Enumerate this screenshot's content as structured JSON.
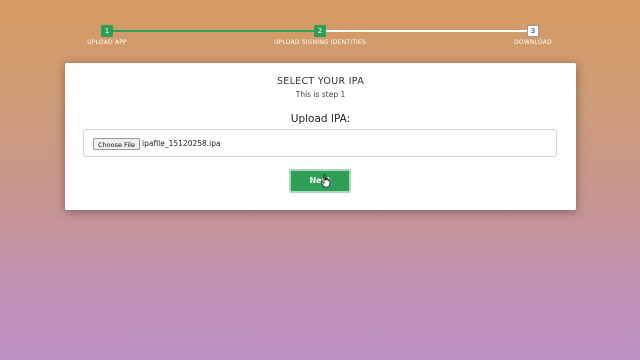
{
  "stepper": {
    "steps": [
      {
        "number": "1",
        "label": "UPLOAD APP",
        "state": "done"
      },
      {
        "number": "2",
        "label": "UPLOAD SIGNING IDENTITIES",
        "state": "done"
      },
      {
        "number": "3",
        "label": "DOWNLOAD",
        "state": "todo"
      }
    ]
  },
  "card": {
    "title": "SELECT YOUR IPA",
    "subtitle": "This is step 1",
    "upload_label": "Upload IPA:",
    "file_input": {
      "button_label": "Choose File",
      "file_name": "ipafile_15120258.ipa"
    },
    "next_label": "Next"
  },
  "colors": {
    "accent": "#2f9e57",
    "background_top": "#d49a62",
    "background_bottom": "#bd8fc3"
  },
  "icons": {
    "cursor": "hand-pointer-icon"
  }
}
